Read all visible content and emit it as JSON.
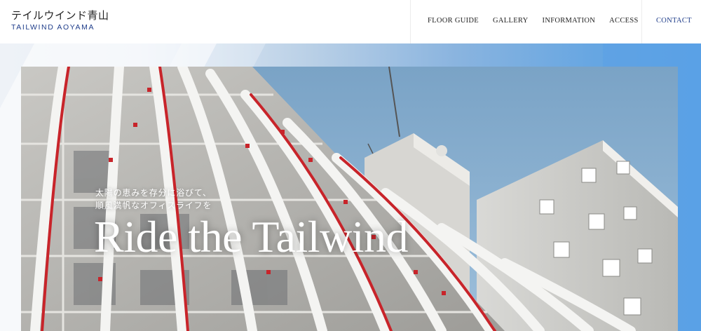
{
  "header": {
    "logo_jp": "テイルウインド青山",
    "logo_en": "TAILWIND AOYAMA",
    "nav": [
      "FLOOR GUIDE",
      "GALLERY",
      "INFORMATION",
      "ACCESS"
    ],
    "contact": "CONTACT"
  },
  "hero": {
    "subtitle_line1": "太陽の恵みを存分に浴びて、",
    "subtitle_line2": "順風満帆なオフィスライフを",
    "title": "Ride the Tailwind"
  },
  "colors": {
    "brand_blue": "#1f3d8a",
    "sky": "#7ea9cd",
    "fin_red": "#c8242a",
    "gradient_end": "#5aa2e6"
  }
}
